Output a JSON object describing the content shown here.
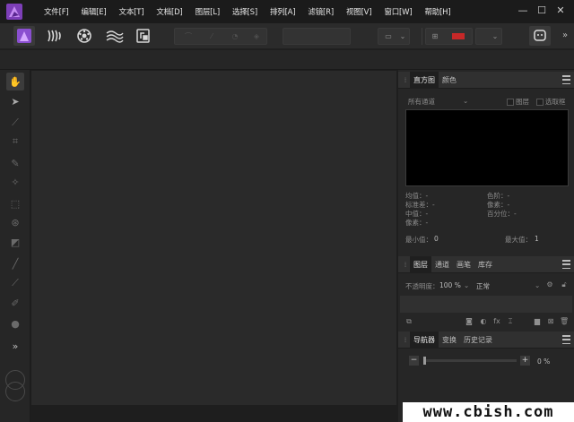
{
  "menubar": {
    "items": [
      "文件[F]",
      "编辑[E]",
      "文本[T]",
      "文档[D]",
      "图层[L]",
      "选择[S]",
      "排列[A]",
      "滤镜[R]",
      "视图[V]",
      "窗口[W]",
      "帮助[H]"
    ],
    "minimize": "—",
    "maximize": "☐",
    "close": "✕"
  },
  "toolbar": {
    "more": "»"
  },
  "tools": {
    "more": "»"
  },
  "colors": {
    "accent": "#9b59d9",
    "bg": "#1e1e1e",
    "canvas": "#2a2a2a"
  },
  "histogram": {
    "tab_active": "直方图",
    "tab_color": "颜色",
    "channel": "所有通道",
    "layer_label": "图层",
    "selection_label": "选取框",
    "stats_left": [
      "均值：-",
      "标准差：-",
      "中值：-",
      "像素：-"
    ],
    "stats_right": [
      "色阶：-",
      "像素：-",
      "百分位：-"
    ],
    "min_label": "最小值：",
    "min_value": "0",
    "max_label": "最大值：",
    "max_value": "1"
  },
  "layers": {
    "tabs": [
      "图层",
      "通道",
      "画笔",
      "库存"
    ],
    "opacity_label": "不透明度：",
    "opacity_value": "100 %",
    "blend_mode": "正常"
  },
  "navigator": {
    "tabs": [
      "导航器",
      "变换",
      "历史记录"
    ],
    "zoom_value": "0 %",
    "zoom_out": "−",
    "zoom_in": "+"
  },
  "watermark": "www.cbish.com"
}
